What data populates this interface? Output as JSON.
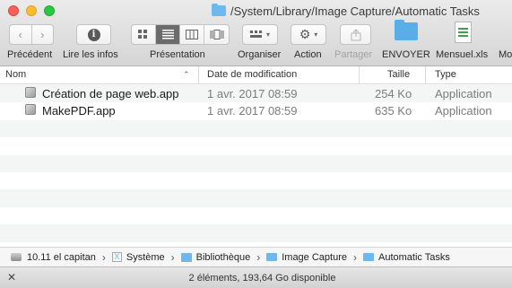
{
  "window": {
    "title": "/System/Library/Image Capture/Automatic Tasks"
  },
  "toolbar": {
    "back_label": "Précédent",
    "info_label": "Lire les infos",
    "view_label": "Présentation",
    "arrange_label": "Organiser",
    "action_label": "Action",
    "share_label": "Partager",
    "send_label": "ENVOYER",
    "file_label": "Mensuel.xls",
    "more_label": "Mo"
  },
  "columns": {
    "name": "Nom",
    "date": "Date de modification",
    "size": "Taille",
    "type": "Type"
  },
  "files": [
    {
      "name": "Création de page web.app",
      "date": "1 avr. 2017 08:59",
      "size": "254 Ko",
      "type": "Application"
    },
    {
      "name": "MakePDF.app",
      "date": "1 avr. 2017 08:59",
      "size": "635 Ko",
      "type": "Application"
    }
  ],
  "pathbar": {
    "disk": "10.11 el capitan",
    "system": "Système",
    "library": "Bibliothèque",
    "image_capture": "Image Capture",
    "automatic_tasks": "Automatic Tasks"
  },
  "status": {
    "text": "2 éléments, 193,64 Go disponible"
  }
}
